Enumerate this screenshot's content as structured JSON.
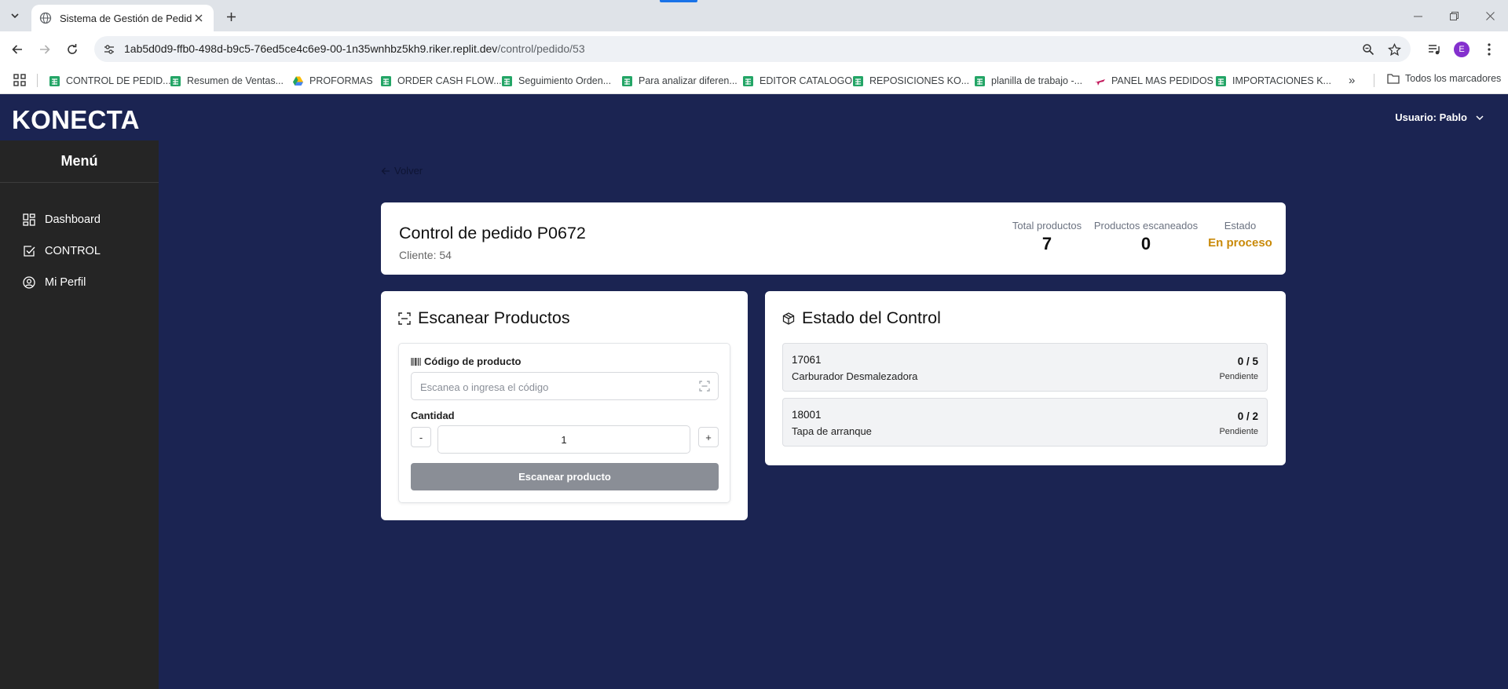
{
  "browser": {
    "tab_title": "Sistema de Gestión de Pedidos",
    "url_host": "1ab5d0d9-ffb0-498d-b9c5-76ed5ce4c6e9-00-1n35wnhbz5kh9.riker.replit.dev",
    "url_path": "/control/pedido/53",
    "profile_initial": "E",
    "bookmarks": [
      "CONTROL DE PEDID...",
      "Resumen de Ventas...",
      "PROFORMAS",
      "ORDER CASH FLOW...",
      "Seguimiento Orden...",
      "Para analizar diferen...",
      "EDITOR CATALOGO",
      "REPOSICIONES KO...",
      "planilla de trabajo -...",
      "PANEL MAS PEDIDOS",
      "IMPORTACIONES K..."
    ],
    "bookmarks_overflow": "»",
    "all_bookmarks": "Todos los marcadores"
  },
  "app": {
    "brand": "KONECTA",
    "user_label": "Usuario: Pablo"
  },
  "sidebar": {
    "title": "Menú",
    "items": [
      {
        "label": "Dashboard",
        "icon": "dashboard-icon"
      },
      {
        "label": "CONTROL",
        "icon": "checkbox-icon"
      },
      {
        "label": "Mi Perfil",
        "icon": "user-circle-icon"
      }
    ]
  },
  "main": {
    "back_label": "Volver",
    "order": {
      "title": "Control de pedido P0672",
      "client": "Cliente: 54",
      "stats": {
        "total_label": "Total productos",
        "total_value": "7",
        "scanned_label": "Productos escaneados",
        "scanned_value": "0",
        "status_label": "Estado",
        "status_value": "En proceso"
      }
    },
    "scan": {
      "title": "Escanear Productos",
      "code_label": "Código de producto",
      "code_placeholder": "Escanea o ingresa el código",
      "qty_label": "Cantidad",
      "qty_minus": "-",
      "qty_value": "1",
      "qty_plus": "+",
      "button_label": "Escanear producto"
    },
    "control": {
      "title": "Estado del Control",
      "products": [
        {
          "code": "17061",
          "name": "Carburador Desmalezadora",
          "count": "0 / 5",
          "status": "Pendiente"
        },
        {
          "code": "18001",
          "name": "Tapa de arranque",
          "count": "0 / 2",
          "status": "Pendiente"
        }
      ]
    }
  },
  "colors": {
    "app_bg": "#1b2452",
    "sidebar_bg": "#252525",
    "status_accent": "#c98a0a",
    "button_disabled": "#8a8e96"
  }
}
